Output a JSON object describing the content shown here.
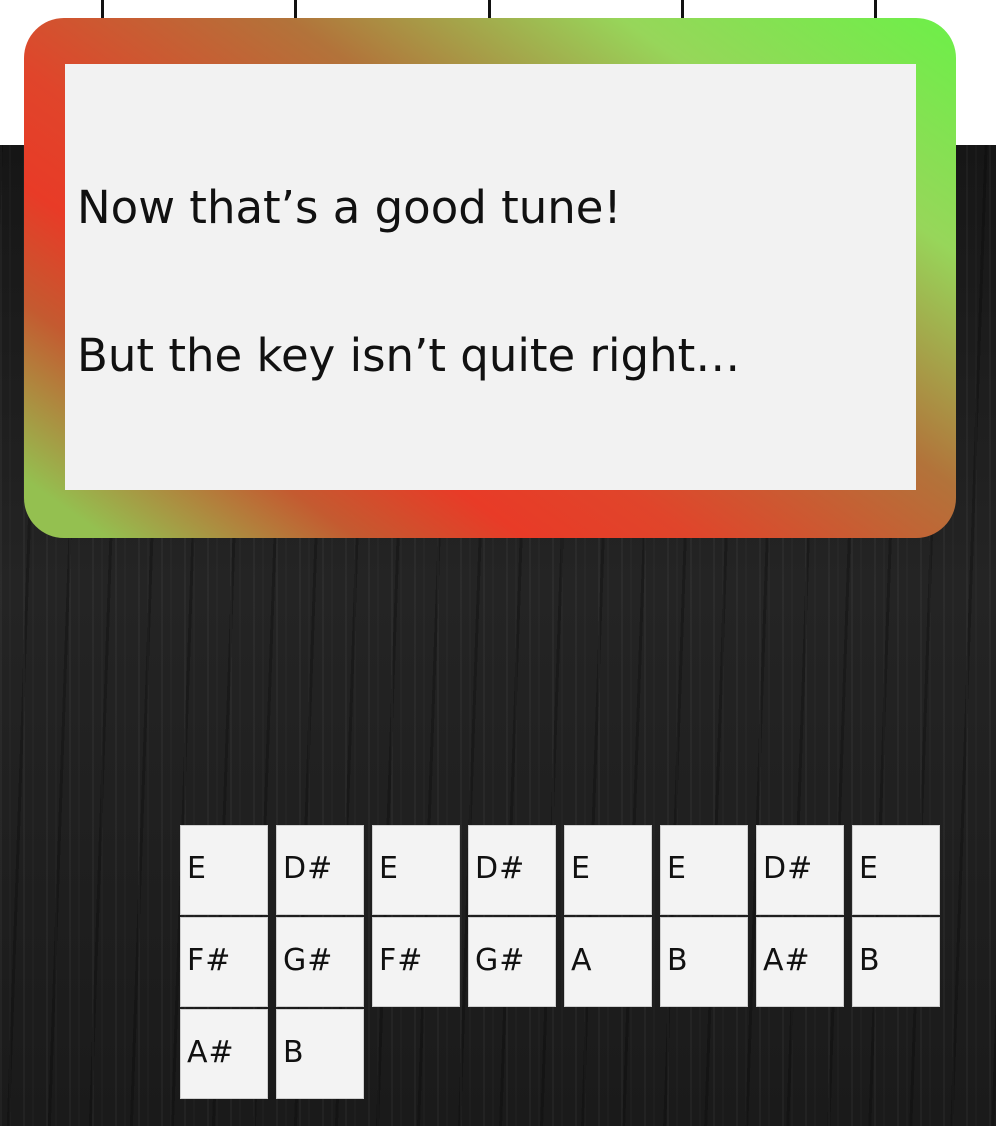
{
  "dialog": {
    "line1": "Now that’s a good tune!",
    "line2": "But the key isn’t quite right…"
  },
  "notes": {
    "rows": [
      [
        "E",
        "D#",
        "E",
        "D#",
        "E",
        "E",
        "D#",
        "E"
      ],
      [
        "F#",
        "G#",
        "F#",
        "G#",
        "A",
        "B",
        "A#",
        "B"
      ],
      [
        "A#",
        "B"
      ]
    ]
  },
  "colors": {
    "frame_green": "#6cf048",
    "frame_red": "#e83b27",
    "dialog_bg": "#f2f2f2",
    "board_bg": "#1c1c1c",
    "tile_bg": "#f3f3f3"
  }
}
